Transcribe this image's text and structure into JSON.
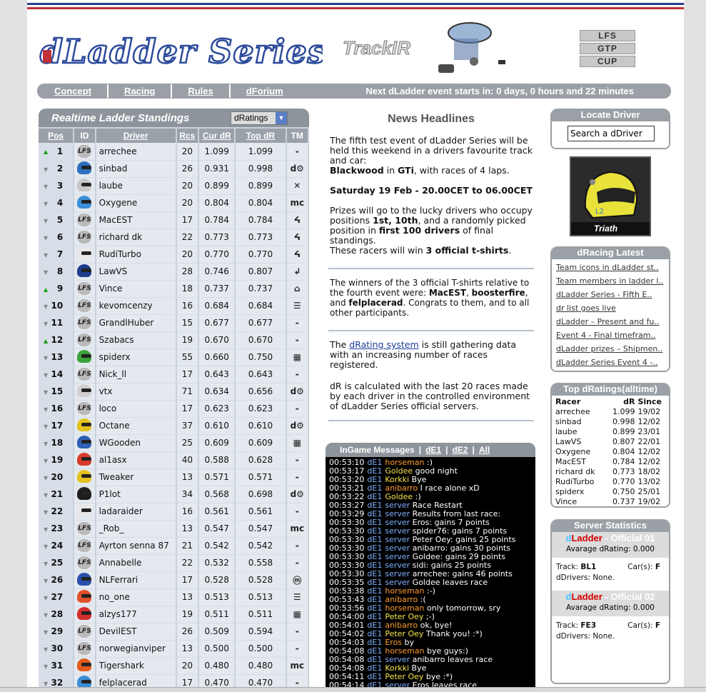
{
  "header": {
    "logo_text": "dLadder Series",
    "sponsor_text": "TrackIR",
    "type_buttons": [
      "LFS",
      "GTP",
      "CUP"
    ]
  },
  "nav": {
    "links": [
      "Concept",
      "Racing",
      "Rules",
      "dForium"
    ],
    "next_event": "Next dLadder event starts in: 0 days, 0 hours and 22 minutes"
  },
  "ladder": {
    "title": "Realtime Ladder Standings",
    "selector": "dRatings",
    "columns": [
      "Pos",
      "ID",
      "Driver",
      "Rcs",
      "Cur dR",
      "Top dR",
      "TM"
    ],
    "rows": [
      {
        "pos": "1",
        "mv": "up",
        "helmet": "lfs",
        "driver": "arrechee",
        "rcs": "20",
        "cur": "1.099",
        "top": "1.099",
        "tm": "-"
      },
      {
        "pos": "2",
        "mv": "down",
        "helmet": "#2f6fbf",
        "driver": "sinbad",
        "rcs": "26",
        "cur": "0.931",
        "top": "0.998",
        "tm": "d⚙"
      },
      {
        "pos": "3",
        "mv": "down",
        "helmet": "#c8c8c8",
        "driver": "laube",
        "rcs": "20",
        "cur": "0.899",
        "top": "0.899",
        "tm": "✕"
      },
      {
        "pos": "4",
        "mv": "down",
        "helmet": "#3a8fd6",
        "driver": "Oxygene",
        "rcs": "20",
        "cur": "0.804",
        "top": "0.804",
        "tm": "mc"
      },
      {
        "pos": "5",
        "mv": "down",
        "helmet": "lfs",
        "driver": "MacEST",
        "rcs": "17",
        "cur": "0.784",
        "top": "0.784",
        "tm": "ᔦ"
      },
      {
        "pos": "6",
        "mv": "down",
        "helmet": "lfs",
        "driver": "richard dk",
        "rcs": "22",
        "cur": "0.773",
        "top": "0.773",
        "tm": "ᔦ"
      },
      {
        "pos": "7",
        "mv": "down",
        "helmet": "#e8e8e8",
        "driver": "RudiTurbo",
        "rcs": "20",
        "cur": "0.770",
        "top": "0.770",
        "tm": "ᔦ"
      },
      {
        "pos": "8",
        "mv": "down",
        "helmet": "#1c3d8c",
        "driver": "LawVS",
        "rcs": "28",
        "cur": "0.746",
        "top": "0.807",
        "tm": "↲"
      },
      {
        "pos": "9",
        "mv": "up",
        "helmet": "lfs",
        "driver": "Vince",
        "rcs": "18",
        "cur": "0.737",
        "top": "0.737",
        "tm": "⌂"
      },
      {
        "pos": "10",
        "mv": "down",
        "helmet": "lfs",
        "driver": "kevomcenzy",
        "rcs": "16",
        "cur": "0.684",
        "top": "0.684",
        "tm": "☰"
      },
      {
        "pos": "11",
        "mv": "down",
        "helmet": "lfs",
        "driver": "GrandlHuber",
        "rcs": "15",
        "cur": "0.677",
        "top": "0.677",
        "tm": "-"
      },
      {
        "pos": "12",
        "mv": "up",
        "helmet": "lfs",
        "driver": "Szabacs",
        "rcs": "19",
        "cur": "0.670",
        "top": "0.670",
        "tm": "-"
      },
      {
        "pos": "13",
        "mv": "down",
        "helmet": "#3ba13b",
        "driver": "spiderx",
        "rcs": "55",
        "cur": "0.660",
        "top": "0.750",
        "tm": "▦"
      },
      {
        "pos": "14",
        "mv": "down",
        "helmet": "lfs",
        "driver": "Nick_ll",
        "rcs": "17",
        "cur": "0.643",
        "top": "0.643",
        "tm": "-"
      },
      {
        "pos": "15",
        "mv": "down",
        "helmet": "#d0d0d0",
        "driver": "vtx",
        "rcs": "71",
        "cur": "0.634",
        "top": "0.656",
        "tm": "d⚙"
      },
      {
        "pos": "16",
        "mv": "down",
        "helmet": "lfs",
        "driver": "loco",
        "rcs": "17",
        "cur": "0.623",
        "top": "0.623",
        "tm": "-"
      },
      {
        "pos": "17",
        "mv": "down",
        "helmet": "#e3c21d",
        "driver": "Octane",
        "rcs": "37",
        "cur": "0.610",
        "top": "0.610",
        "tm": "d⚙"
      },
      {
        "pos": "18",
        "mv": "down",
        "helmet": "#2d5fb5",
        "driver": "WGooden",
        "rcs": "25",
        "cur": "0.609",
        "top": "0.609",
        "tm": "▦"
      },
      {
        "pos": "19",
        "mv": "down",
        "helmet": "#d63b2a",
        "driver": "al1asx",
        "rcs": "40",
        "cur": "0.588",
        "top": "0.628",
        "tm": "-"
      },
      {
        "pos": "20",
        "mv": "down",
        "helmet": "#e3c21d",
        "driver": "Tweaker",
        "rcs": "13",
        "cur": "0.571",
        "top": "0.571",
        "tm": "-"
      },
      {
        "pos": "21",
        "mv": "down",
        "helmet": "#1e1e1e",
        "driver": "P1lot",
        "rcs": "34",
        "cur": "0.568",
        "top": "0.698",
        "tm": "d⚙"
      },
      {
        "pos": "22",
        "mv": "down",
        "helmet": "#e8e8e8",
        "driver": "ladaraider",
        "rcs": "16",
        "cur": "0.561",
        "top": "0.561",
        "tm": "-"
      },
      {
        "pos": "23",
        "mv": "down",
        "helmet": "lfs",
        "driver": "_Rob_",
        "rcs": "13",
        "cur": "0.547",
        "top": "0.547",
        "tm": "mc"
      },
      {
        "pos": "24",
        "mv": "down",
        "helmet": "lfs",
        "driver": "Ayrton senna 87",
        "rcs": "21",
        "cur": "0.542",
        "top": "0.542",
        "tm": "-"
      },
      {
        "pos": "25",
        "mv": "down",
        "helmet": "lfs",
        "driver": "Annabelle",
        "rcs": "22",
        "cur": "0.532",
        "top": "0.558",
        "tm": "-"
      },
      {
        "pos": "26",
        "mv": "down",
        "helmet": "#2a4fae",
        "driver": "NLFerrari",
        "rcs": "17",
        "cur": "0.528",
        "top": "0.528",
        "tm": "ⓜ"
      },
      {
        "pos": "27",
        "mv": "down",
        "helmet": "#e0502b",
        "driver": "no_one",
        "rcs": "13",
        "cur": "0.513",
        "top": "0.513",
        "tm": "☰"
      },
      {
        "pos": "28",
        "mv": "down",
        "helmet": "#d32d2d",
        "driver": "alzys177",
        "rcs": "19",
        "cur": "0.511",
        "top": "0.511",
        "tm": "▦"
      },
      {
        "pos": "29",
        "mv": "down",
        "helmet": "lfs",
        "driver": "DevilEST",
        "rcs": "26",
        "cur": "0.509",
        "top": "0.594",
        "tm": "-"
      },
      {
        "pos": "30",
        "mv": "down",
        "helmet": "lfs",
        "driver": "norwegianviper",
        "rcs": "13",
        "cur": "0.500",
        "top": "0.500",
        "tm": "-"
      },
      {
        "pos": "31",
        "mv": "down",
        "helmet": "#e25a1c",
        "driver": "Tigershark",
        "rcs": "20",
        "cur": "0.480",
        "top": "0.480",
        "tm": "mc"
      },
      {
        "pos": "32",
        "mv": "down",
        "helmet": "#3a8fd6",
        "driver": "felplacerad",
        "rcs": "17",
        "cur": "0.470",
        "top": "0.470",
        "tm": "-"
      }
    ]
  },
  "news": {
    "title": "News Headlines",
    "p1_a": "The fifth test event of dLadder Series will be held this weekend in a drivers favourite track and car:",
    "p1_track": "Blackwood",
    "p1_in": " in ",
    "p1_car": "GTi",
    "p1_b": ", with races of 4 laps.",
    "p2": "Saturday 19 Feb - 20.00CET to 06.00CET",
    "p3_a": "Prizes will go to the lucky drivers who occupy positions ",
    "p3_pos": "1st, 10th",
    "p3_b": ", and a randomly picked position in ",
    "p3_first": "first 100 drivers",
    "p3_c": " of final standings.",
    "p3_d": "These racers will win ",
    "p3_shirts": "3 official t-shirts",
    "p3_e": ".",
    "p4_a": "The winners of the 3 official T-shirts relative to the fourth event were: ",
    "p4_w1": "MacEST",
    "p4_w2": "boosterfire",
    "p4_and": ", and ",
    "p4_w3": "felplacerad",
    "p4_b": ". Congrats to them, and to all other participants.",
    "p5_a": "The ",
    "p5_link": "dRating system",
    "p5_b": " is still gathering data with an increasing number of races registered.",
    "p6": "dR is calculated with the last 20 races made by each driver in the controlled environment of dLadder Series official servers."
  },
  "ingame": {
    "title": "InGame Messages",
    "tabs": [
      "dE1",
      "dE2",
      "All"
    ],
    "lines": [
      {
        "t": "00:53:10",
        "ch": "dE1",
        "n": "horseman",
        "c": "nm",
        "m": " :)"
      },
      {
        "t": "00:53:17",
        "ch": "dE1",
        "n": "Goldee",
        "c": "nmy",
        "m": " good night"
      },
      {
        "t": "00:53:20",
        "ch": "dE1",
        "n": "Korkki",
        "c": "nmy",
        "m": " Bye"
      },
      {
        "t": "00:53:21",
        "ch": "dE1",
        "n": "anibarro",
        "c": "nm",
        "m": " I race alone xD"
      },
      {
        "t": "00:53:22",
        "ch": "dE1",
        "n": "Goldee",
        "c": "nmy",
        "m": " :)"
      },
      {
        "t": "00:53:27",
        "ch": "dE1",
        "n": "server",
        "c": "ch",
        "m": " Race Restart"
      },
      {
        "t": "00:53:29",
        "ch": "dE1",
        "n": "server",
        "c": "ch",
        "m": " Results from last race:"
      },
      {
        "t": "00:53:30",
        "ch": "dE1",
        "n": "server",
        "c": "ch",
        "m": " Eros: gains 7 points"
      },
      {
        "t": "00:53:30",
        "ch": "dE1",
        "n": "server",
        "c": "ch",
        "m": " spider76: gains 7 points"
      },
      {
        "t": "00:53:30",
        "ch": "dE1",
        "n": "server",
        "c": "ch",
        "m": " Peter Oey: gains 25 points"
      },
      {
        "t": "00:53:30",
        "ch": "dE1",
        "n": "server",
        "c": "ch",
        "m": " anibarro: gains 30 points"
      },
      {
        "t": "00:53:30",
        "ch": "dE1",
        "n": "server",
        "c": "ch",
        "m": " Goldee: gains 29 points"
      },
      {
        "t": "00:53:30",
        "ch": "dE1",
        "n": "server",
        "c": "ch",
        "m": " sidi: gains 25 points"
      },
      {
        "t": "00:53:30",
        "ch": "dE1",
        "n": "server",
        "c": "ch",
        "m": " arrechee: gains 46 points"
      },
      {
        "t": "00:53:35",
        "ch": "dE1",
        "n": "server",
        "c": "ch",
        "m": " Goldee leaves race"
      },
      {
        "t": "00:53:38",
        "ch": "dE1",
        "n": "horseman",
        "c": "nm",
        "m": " :-)"
      },
      {
        "t": "00:53:43",
        "ch": "dE1",
        "n": "anibarro",
        "c": "nm",
        "m": " :("
      },
      {
        "t": "00:53:56",
        "ch": "dE1",
        "n": "horseman",
        "c": "nm",
        "m": " only tomorrow, sry"
      },
      {
        "t": "00:54:00",
        "ch": "dE1",
        "n": "Peter Oey",
        "c": "nmy",
        "m": " ;-)"
      },
      {
        "t": "00:54:01",
        "ch": "dE1",
        "n": "anibarro",
        "c": "nm",
        "m": " ok, bye!"
      },
      {
        "t": "00:54:02",
        "ch": "dE1",
        "n": "Peter Oey",
        "c": "nmy",
        "m": " Thank you! :*)"
      },
      {
        "t": "00:54:03",
        "ch": "dE1",
        "n": "Eros",
        "c": "nm",
        "m": " by"
      },
      {
        "t": "00:54:08",
        "ch": "dE1",
        "n": "horseman",
        "c": "nm",
        "m": " bye guys:)"
      },
      {
        "t": "00:54:08",
        "ch": "dE1",
        "n": "server",
        "c": "ch",
        "m": " anibarro leaves race"
      },
      {
        "t": "00:54:08",
        "ch": "dE1",
        "n": "Korkki",
        "c": "nmy",
        "m": " Bye"
      },
      {
        "t": "00:54:11",
        "ch": "dE1",
        "n": "Peter Oey",
        "c": "nmy",
        "m": " bye :*)"
      },
      {
        "t": "00:54:14",
        "ch": "dE1",
        "n": "server",
        "c": "ch",
        "m": " Eros leaves race"
      }
    ]
  },
  "locate": {
    "title": "Locate Driver",
    "placeholder": "Search a dDriver"
  },
  "avatar": {
    "name": "Triath"
  },
  "latest": {
    "title": "dRacing Latest",
    "items": [
      "Team icons in dLadder st..",
      "Team members in ladder l..",
      "dLadder Series - Fifth E..",
      "dr list goes live",
      "dLadder – Present and fu..",
      "Event 4 - Final timefram..",
      "dLadder prizes – Shipmen..",
      "dLadder Series Event 4 -.."
    ]
  },
  "topdr": {
    "title": "Top dRatings(alltime)",
    "headers": [
      "Racer",
      "dR",
      "Since"
    ],
    "rows": [
      [
        "arrechee",
        "1.099",
        "19/02"
      ],
      [
        "sinbad",
        "0.998",
        "12/02"
      ],
      [
        "laube",
        "0.899",
        "23/01"
      ],
      [
        "LawVS",
        "0.807",
        "22/01"
      ],
      [
        "Oxygene",
        "0.804",
        "12/02"
      ],
      [
        "MacEST",
        "0.784",
        "12/02"
      ],
      [
        "richard dk",
        "0.773",
        "18/02"
      ],
      [
        "RudiTurbo",
        "0.770",
        "13/02"
      ],
      [
        "spiderx",
        "0.750",
        "25/01"
      ],
      [
        "Vince",
        "0.737",
        "19/02"
      ]
    ]
  },
  "stats": {
    "title": "Server Statistics",
    "servers": [
      {
        "d": "d",
        "l": "Ladder",
        "suffix": " - Official 01",
        "avg": "Avarage dRating: 0.000",
        "track_label": "Track:",
        "track": "BL1",
        "cars_label": "Car(s):",
        "cars": "F",
        "drivers": "dDrivers: None."
      },
      {
        "d": "d",
        "l": "Ladder",
        "suffix": " - Official 02",
        "avg": "Avarage dRating: 0.000",
        "track_label": "Track:",
        "track": "FE3",
        "cars_label": "Car(s):",
        "cars": "F",
        "drivers": "dDrivers: None."
      }
    ]
  },
  "colors": {
    "accent_blue": "#2b4a9b",
    "header_grey": "#9aa0a6",
    "ladder_bg": "#c9d2dc",
    "stripe_red": "#c0303a",
    "stripe_blue": "#2a3f8f"
  }
}
